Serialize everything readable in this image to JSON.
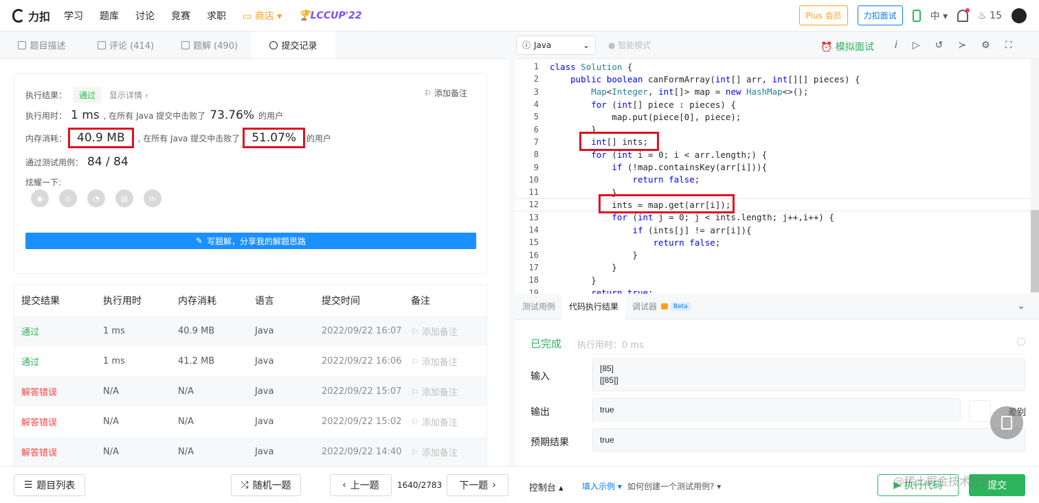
{
  "topbar": {
    "logo": "力扣",
    "nav": [
      "学习",
      "题库",
      "讨论",
      "竞赛",
      "求职"
    ],
    "store": "商店",
    "lccup": "LCCUP'22",
    "plus": "Plus 会员",
    "interview": "力扣面试",
    "lang": "中",
    "streak": "15"
  },
  "tabs": [
    {
      "label": "题目描述"
    },
    {
      "label": "评论 (414)"
    },
    {
      "label": "题解 (490)"
    },
    {
      "label": "提交记录"
    }
  ],
  "result": {
    "result_label": "执行结果：",
    "status": "通过",
    "detail": "显示详情 ›",
    "add_note": "添加备注",
    "time_label": "执行用时：",
    "time_value": "1 ms",
    "time_beat_text": ", 在所有 Java 提交中击败了",
    "time_percent": "73.76%",
    "users": "的用户",
    "mem_label": "内存消耗：",
    "mem_value": "40.9 MB",
    "mem_beat_text": ", 在所有 Java 提交中击败了",
    "mem_percent": "51.07%",
    "cases_label": "通过测试用例：",
    "cases_value": "84 / 84",
    "share_label": "炫耀一下:",
    "write_solution": "写题解，分享我的解题思路"
  },
  "submissions": {
    "headers": [
      "提交结果",
      "执行用时",
      "内存消耗",
      "语言",
      "提交时间",
      "备注"
    ],
    "rows": [
      {
        "status": "通过",
        "time": "1 ms",
        "mem": "40.9 MB",
        "lang": "Java",
        "date": "2022/09/22 16:07",
        "note": "添加备注"
      },
      {
        "status": "通过",
        "time": "1 ms",
        "mem": "41.2 MB",
        "lang": "Java",
        "date": "2022/09/22 16:06",
        "note": "添加备注"
      },
      {
        "status": "解答错误",
        "time": "N/A",
        "mem": "N/A",
        "lang": "Java",
        "date": "2022/09/22 15:07",
        "note": "添加备注"
      },
      {
        "status": "解答错误",
        "time": "N/A",
        "mem": "N/A",
        "lang": "Java",
        "date": "2022/09/22 15:02",
        "note": "添加备注"
      },
      {
        "status": "解答错误",
        "time": "N/A",
        "mem": "N/A",
        "lang": "Java",
        "date": "2022/09/22 14:40",
        "note": "添加备注"
      }
    ]
  },
  "editor": {
    "language": "Java",
    "smart_mode": "智能模式",
    "mock_interview": "模拟面试",
    "code_lines": [
      "class Solution {",
      "    public boolean canFormArray(int[] arr, int[][] pieces) {",
      "        Map<Integer, int[]> map = new HashMap<>();",
      "        for (int[] piece : pieces) {",
      "            map.put(piece[0], piece);",
      "        }",
      "        int[] ints;",
      "        for (int i = 0; i < arr.length;) {",
      "            if (!map.containsKey(arr[i])){",
      "                return false;",
      "            }",
      "            ints = map.get(arr[i]);",
      "            for (int j = 0; j < ints.length; j++,i++) {",
      "                if (ints[j] != arr[i]){",
      "                    return false;",
      "                }",
      "            }",
      "        }",
      "        return true;"
    ]
  },
  "console_panel": {
    "tabs": [
      "测试用例",
      "代码执行结果",
      "调试器"
    ],
    "beta": "Beta",
    "done": "已完成",
    "exec_time": "执行用时：0 ms",
    "input_label": "输入",
    "input_lines": [
      "[85]",
      "[[85]]"
    ],
    "output_label": "输出",
    "output_value": "true",
    "diff_label": "差别",
    "expected_label": "预期结果",
    "expected_value": "true"
  },
  "bottom": {
    "problem_list": "题目列表",
    "random": "随机一题",
    "prev": "上一题",
    "pager": "1640/2783",
    "next": "下一题",
    "console": "控制台",
    "fill_example": "填入示例",
    "how_create": "如何创建一个测试用例?",
    "run": "执行代码",
    "submit": "提交",
    "watermark": "@稀土掘金技术社区"
  }
}
